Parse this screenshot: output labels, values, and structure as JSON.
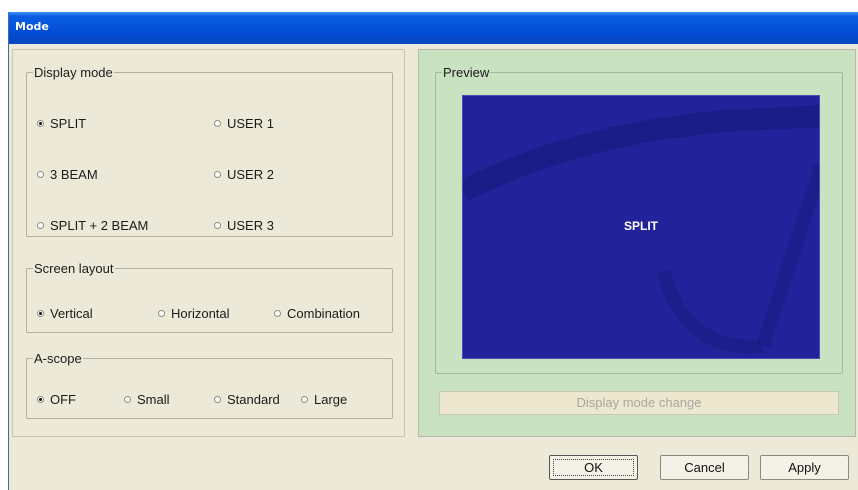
{
  "window": {
    "title": "Mode"
  },
  "display_mode": {
    "legend": "Display mode",
    "options": [
      "SPLIT",
      "USER 1",
      "3 BEAM",
      "USER 2",
      "SPLIT + 2 BEAM",
      "USER 3"
    ],
    "selected": "SPLIT"
  },
  "screen_layout": {
    "legend": "Screen layout",
    "options": [
      "Vertical",
      "Horizontal",
      "Combination"
    ],
    "selected": "Vertical"
  },
  "a_scope": {
    "legend": "A-scope",
    "options": [
      "OFF",
      "Small",
      "Standard",
      "Large"
    ],
    "selected": "OFF"
  },
  "preview": {
    "legend": "Preview",
    "mode_label": "SPLIT"
  },
  "display_mode_change": "Display mode change",
  "buttons": {
    "ok": "OK",
    "cancel": "Cancel",
    "apply": "Apply"
  },
  "colors": {
    "title_bar": "#0550d9",
    "preview_bg": "#22239a",
    "dialog_bg": "#ece9d8",
    "preview_panel_bg": "#c9e2c2"
  }
}
